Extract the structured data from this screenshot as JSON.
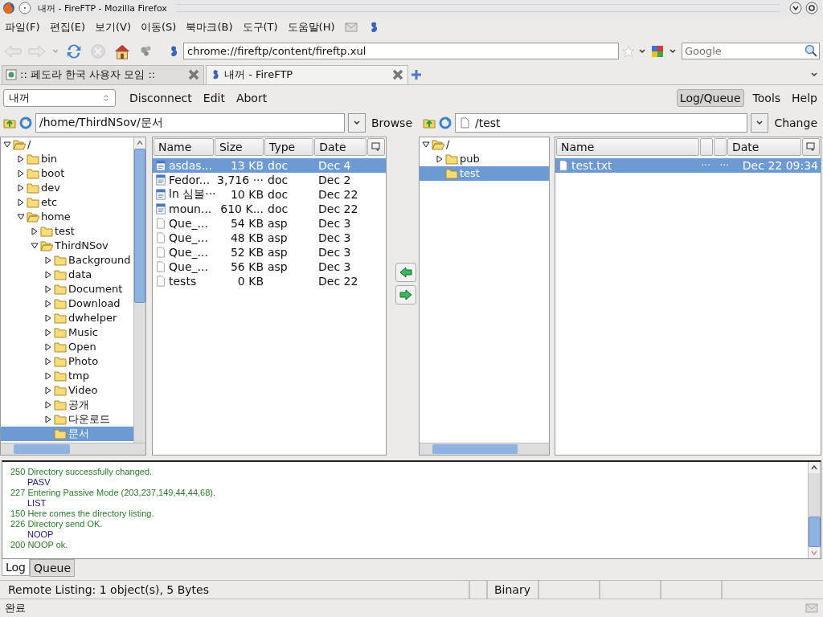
{
  "window": {
    "title": "내꺼 - FireFTP - Mozilla Firefox"
  },
  "menu": [
    "파일(F)",
    "편집(E)",
    "보기(V)",
    "이동(S)",
    "북마크(B)",
    "도구(T)",
    "도움말(H)"
  ],
  "address": {
    "value": "chrome://fireftp/content/fireftp.xul"
  },
  "search": {
    "placeholder": "Google"
  },
  "tabs": [
    {
      "label": ":: 페도라 한국 사용자 모임 ::",
      "selected": false
    },
    {
      "label": "내꺼 - FireFTP",
      "selected": true
    }
  ],
  "ftp_toolbar": {
    "account": "내꺼",
    "actions": [
      "Disconnect",
      "Edit",
      "Abort"
    ],
    "right": [
      {
        "label": "Log/Queue",
        "selected": true
      },
      {
        "label": "Tools",
        "selected": false
      },
      {
        "label": "Help",
        "selected": false
      }
    ]
  },
  "local": {
    "path": "/home/ThirdNSov/문서",
    "button": "Browse",
    "tree": [
      {
        "label": "/",
        "expandable": true,
        "expanded": true,
        "selected": false,
        "children": [
          {
            "label": "bin",
            "expandable": true,
            "expanded": false,
            "selected": false
          },
          {
            "label": "boot",
            "expandable": true,
            "expanded": false,
            "selected": false
          },
          {
            "label": "dev",
            "expandable": true,
            "expanded": false,
            "selected": false
          },
          {
            "label": "etc",
            "expandable": true,
            "expanded": false,
            "selected": false
          },
          {
            "label": "home",
            "expandable": true,
            "expanded": true,
            "selected": false,
            "children": [
              {
                "label": "test",
                "expandable": true,
                "expanded": false,
                "selected": false
              },
              {
                "label": "ThirdNSov",
                "expandable": true,
                "expanded": true,
                "selected": false,
                "children": [
                  {
                    "label": "Background",
                    "expandable": true,
                    "expanded": false,
                    "selected": false
                  },
                  {
                    "label": "data",
                    "expandable": true,
                    "expanded": false,
                    "selected": false
                  },
                  {
                    "label": "Document",
                    "expandable": true,
                    "expanded": false,
                    "selected": false
                  },
                  {
                    "label": "Download",
                    "expandable": true,
                    "expanded": false,
                    "selected": false
                  },
                  {
                    "label": "dwhelper",
                    "expandable": true,
                    "expanded": false,
                    "selected": false
                  },
                  {
                    "label": "Music",
                    "expandable": true,
                    "expanded": false,
                    "selected": false
                  },
                  {
                    "label": "Open",
                    "expandable": true,
                    "expanded": false,
                    "selected": false
                  },
                  {
                    "label": "Photo",
                    "expandable": true,
                    "expanded": false,
                    "selected": false
                  },
                  {
                    "label": "tmp",
                    "expandable": true,
                    "expanded": false,
                    "selected": false
                  },
                  {
                    "label": "Video",
                    "expandable": true,
                    "expanded": false,
                    "selected": false
                  },
                  {
                    "label": "공개",
                    "expandable": true,
                    "expanded": false,
                    "selected": false
                  },
                  {
                    "label": "다운로드",
                    "expandable": true,
                    "expanded": false,
                    "selected": false
                  },
                  {
                    "label": "문서",
                    "expandable": false,
                    "expanded": false,
                    "selected": true
                  }
                ]
              }
            ]
          }
        ]
      }
    ],
    "columns": [
      "Name",
      "Size",
      "Type",
      "Date"
    ],
    "files": [
      {
        "kind": "document",
        "name": "asdas...",
        "size": "13 KB",
        "type": "doc",
        "date": "Dec 4",
        "selected": true
      },
      {
        "kind": "document",
        "name": "Fedor...",
        "size": "3,716 ···",
        "type": "doc",
        "date": "Dec 2",
        "selected": false
      },
      {
        "kind": "document",
        "name": "ln 심볼···",
        "size": "10 KB",
        "type": "doc",
        "date": "Dec 22",
        "selected": false
      },
      {
        "kind": "document",
        "name": "moun...",
        "size": "610 K...",
        "type": "doc",
        "date": "Dec 22",
        "selected": false
      },
      {
        "kind": "file",
        "name": "Que_...",
        "size": "54 KB",
        "type": "asp",
        "date": "Dec 3",
        "selected": false
      },
      {
        "kind": "file",
        "name": "Que_...",
        "size": "48 KB",
        "type": "asp",
        "date": "Dec 3",
        "selected": false
      },
      {
        "kind": "file",
        "name": "Que_...",
        "size": "52 KB",
        "type": "asp",
        "date": "Dec 3",
        "selected": false
      },
      {
        "kind": "file",
        "name": "Que_...",
        "size": "56 KB",
        "type": "asp",
        "date": "Dec 3",
        "selected": false
      },
      {
        "kind": "file",
        "name": "tests",
        "size": "0 KB",
        "date": "Dec 22",
        "selected": false
      }
    ]
  },
  "remote": {
    "path": "/test",
    "button": "Change",
    "tree": [
      {
        "label": "/",
        "expandable": true,
        "expanded": true,
        "selected": false,
        "children": [
          {
            "label": "pub",
            "expandable": true,
            "expanded": false,
            "selected": false
          },
          {
            "label": "test",
            "expandable": false,
            "expanded": false,
            "selected": true
          }
        ]
      }
    ],
    "columns": {
      "name": "Name",
      "date": "Date"
    },
    "files": [
      {
        "kind": "file",
        "name": "test.txt",
        "column_2": "···",
        "column_3": "···",
        "date": "Dec 22 09:34",
        "selected": true
      }
    ]
  },
  "log": [
    {
      "kind": "response",
      "text": "250 Directory successfully changed."
    },
    {
      "kind": "command",
      "text": "PASV"
    },
    {
      "kind": "response",
      "text": "227 Entering Passive Mode (203,237,149,44,44,68)."
    },
    {
      "kind": "command",
      "text": "LIST"
    },
    {
      "kind": "response",
      "text": "150 Here comes the directory listing."
    },
    {
      "kind": "response",
      "text": "226 Directory send OK."
    },
    {
      "kind": "command",
      "text": "NOOP"
    },
    {
      "kind": "response",
      "text": "200 NOOP ok."
    }
  ],
  "log_tabs": [
    {
      "label": "Log",
      "selected": true
    },
    {
      "label": "Queue",
      "selected": false
    }
  ],
  "status_bar": {
    "listing": "Remote Listing: 1 object(s), 5 Bytes",
    "mode": "Binary"
  },
  "browser_status": "완료"
}
